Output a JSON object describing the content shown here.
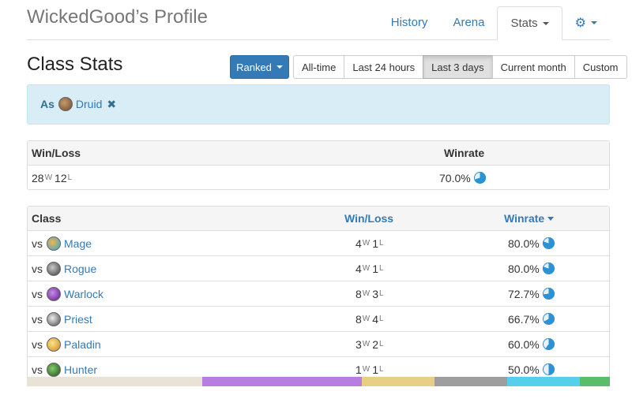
{
  "header": {
    "brand": "WickedGood’s Profile",
    "nav": [
      {
        "label": "History"
      },
      {
        "label": "Arena"
      },
      {
        "label": "Stats"
      }
    ]
  },
  "page": {
    "title": "Class Stats"
  },
  "mode": {
    "label": "Ranked"
  },
  "ranges": [
    {
      "label": "All-time"
    },
    {
      "label": "Last 24 hours"
    },
    {
      "label": "Last 3 days",
      "active": true
    },
    {
      "label": "Current month"
    },
    {
      "label": "Custom"
    }
  ],
  "filter": {
    "prefix": "As",
    "class": "Druid",
    "remove": "✖"
  },
  "summary": {
    "headers": {
      "winloss": "Win/Loss",
      "winrate": "Winrate"
    },
    "wins": "28",
    "losses": "12",
    "w": "W",
    "l": "L",
    "winrate": "70.0%",
    "winrate_value": 0.7
  },
  "classes": {
    "headers": {
      "cls": "Class",
      "winloss": "Win/Loss",
      "winrate": "Winrate"
    },
    "vs": "vs",
    "rows": [
      {
        "name": "Mage",
        "wins": "4",
        "losses": "1",
        "winrate": "80.0%",
        "value": 0.8
      },
      {
        "name": "Rogue",
        "wins": "4",
        "losses": "1",
        "winrate": "80.0%",
        "value": 0.8
      },
      {
        "name": "Warlock",
        "wins": "8",
        "losses": "3",
        "winrate": "72.7%",
        "value": 0.727
      },
      {
        "name": "Priest",
        "wins": "8",
        "losses": "4",
        "winrate": "66.7%",
        "value": 0.667
      },
      {
        "name": "Paladin",
        "wins": "3",
        "losses": "2",
        "winrate": "60.0%",
        "value": 0.6
      },
      {
        "name": "Hunter",
        "wins": "1",
        "losses": "1",
        "winrate": "50.0%",
        "value": 0.5
      }
    ]
  },
  "colors": {
    "accent": "#337ab7",
    "pie": "#2b92d4",
    "distribution": [
      "#e8e3d6",
      "#b77de0",
      "#e8cf86",
      "#9e9e9e",
      "#56d0ea",
      "#5bbd6b"
    ]
  },
  "icons": {
    "settings": "gear-icon",
    "filter_class": "druid-icon"
  }
}
